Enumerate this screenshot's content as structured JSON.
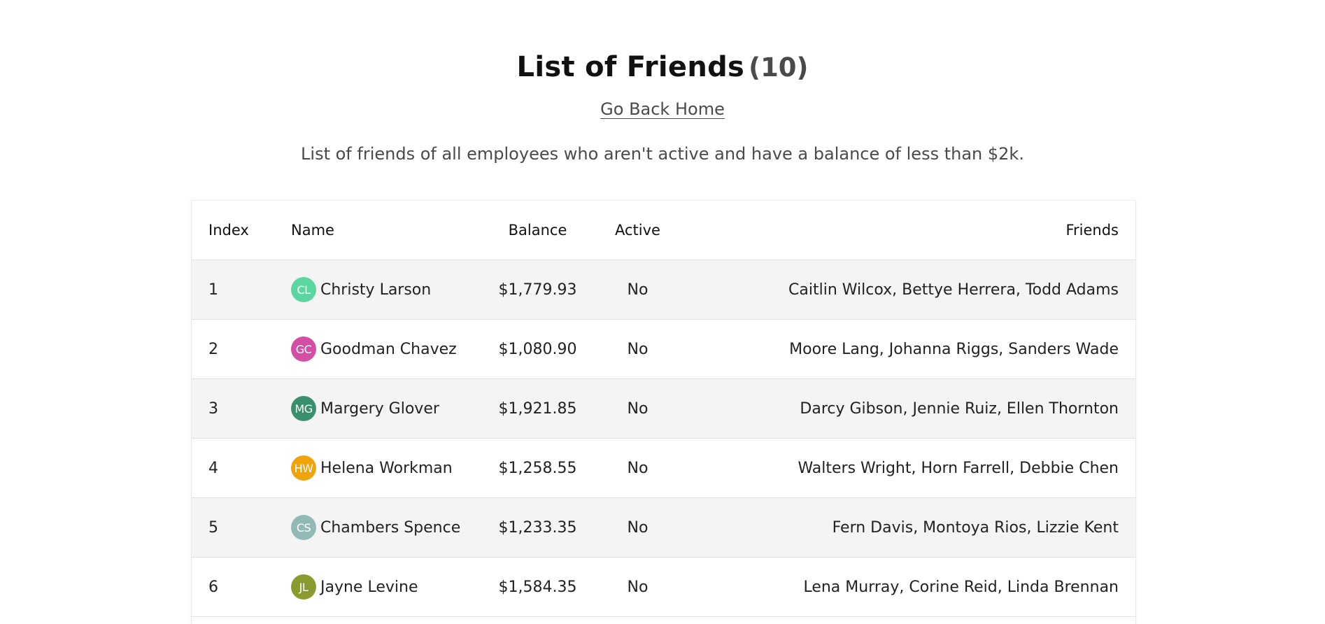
{
  "header": {
    "title": "List of Friends",
    "count": "(10)",
    "back_link": "Go Back Home",
    "description": "List of friends of all employees who aren't active and have a balance of less than $2k."
  },
  "table": {
    "columns": [
      "Index",
      "Name",
      "Balance",
      "Active",
      "Friends"
    ],
    "rows": [
      {
        "index": "1",
        "initials": "CL",
        "avatar_color": "#5cd6a0",
        "name": "Christy Larson",
        "balance": "$1,779.93",
        "active": "No",
        "friends": "Caitlin Wilcox, Bettye Herrera, Todd Adams"
      },
      {
        "index": "2",
        "initials": "GC",
        "avatar_color": "#d44ea6",
        "name": "Goodman Chavez",
        "balance": "$1,080.90",
        "active": "No",
        "friends": "Moore Lang, Johanna Riggs, Sanders Wade"
      },
      {
        "index": "3",
        "initials": "MG",
        "avatar_color": "#3a8f6c",
        "name": "Margery Glover",
        "balance": "$1,921.85",
        "active": "No",
        "friends": "Darcy Gibson, Jennie Ruiz, Ellen Thornton"
      },
      {
        "index": "4",
        "initials": "HW",
        "avatar_color": "#f0a30a",
        "name": "Helena Workman",
        "balance": "$1,258.55",
        "active": "No",
        "friends": "Walters Wright, Horn Farrell, Debbie Chen"
      },
      {
        "index": "5",
        "initials": "CS",
        "avatar_color": "#93b9b7",
        "name": "Chambers Spence",
        "balance": "$1,233.35",
        "active": "No",
        "friends": "Fern Davis, Montoya Rios, Lizzie Kent"
      },
      {
        "index": "6",
        "initials": "JL",
        "avatar_color": "#8a9a2e",
        "name": "Jayne Levine",
        "balance": "$1,584.35",
        "active": "No",
        "friends": "Lena Murray, Corine Reid, Linda Brennan"
      }
    ]
  }
}
